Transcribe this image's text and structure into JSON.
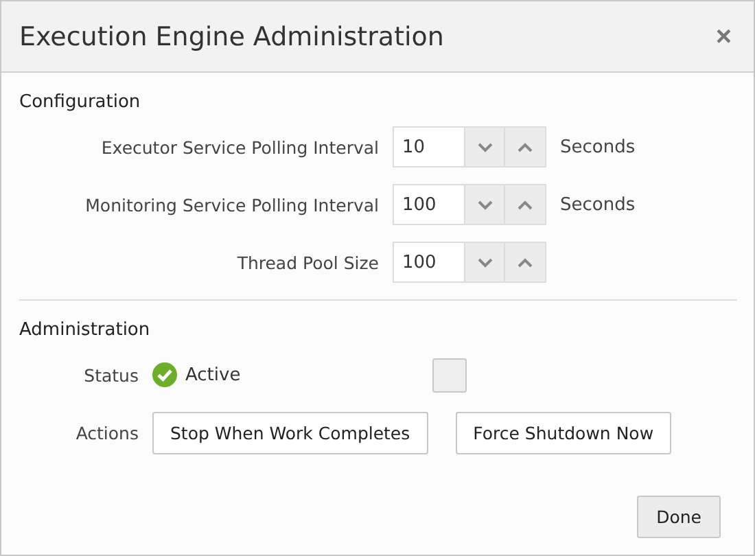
{
  "window": {
    "title": "Execution Engine Administration",
    "close": "×"
  },
  "configuration": {
    "heading": "Configuration",
    "fields": [
      {
        "label": "Executor Service Polling Interval",
        "value": "10",
        "unit": "Seconds"
      },
      {
        "label": "Monitoring Service Polling Interval",
        "value": "100",
        "unit": "Seconds"
      },
      {
        "label": "Thread Pool Size",
        "value": "100"
      }
    ]
  },
  "administration": {
    "heading": "Administration",
    "status": {
      "label": "Status",
      "value": "Active",
      "kind": "ok"
    },
    "actions": {
      "label": "Actions",
      "buttons": [
        "Stop When Work Completes",
        "Force Shutdown Now"
      ]
    }
  },
  "footer": {
    "button": "Done"
  }
}
